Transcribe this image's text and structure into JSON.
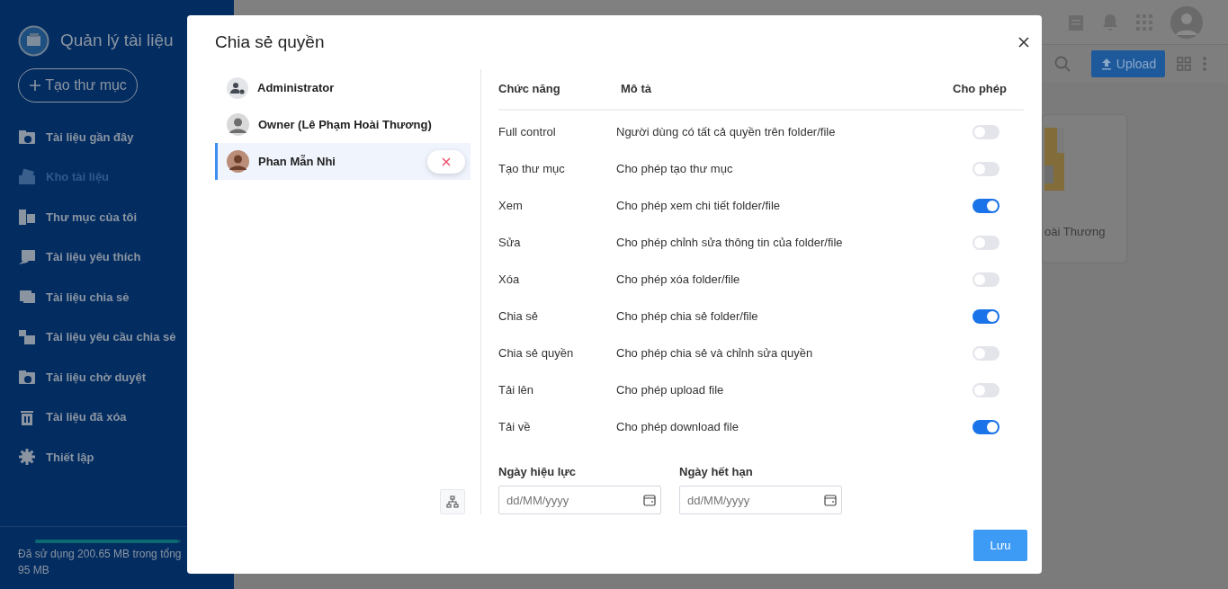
{
  "app": {
    "title": "Quản lý tài liệu",
    "new_folder": "Tạo thư mục"
  },
  "sidebar": {
    "items": [
      {
        "label": "Tài liệu gần đây",
        "selected": false
      },
      {
        "label": "Kho tài liệu",
        "selected": true
      },
      {
        "label": "Thư mục của tôi",
        "selected": false
      },
      {
        "label": "Tài liệu yêu thích",
        "selected": false
      },
      {
        "label": "Tài liệu chia sẻ",
        "selected": false
      },
      {
        "label": "Tài liệu yêu cầu chia sẻ",
        "selected": false
      },
      {
        "label": "Tài liệu chờ duyệt",
        "selected": false
      },
      {
        "label": "Tài liệu đã xóa",
        "selected": false
      },
      {
        "label": "Thiết lập",
        "selected": false
      }
    ],
    "storage": {
      "text": "Đã sử dụng 200.65 MB trong tổng",
      "text_2": "95 MB",
      "level": 0.98
    }
  },
  "toolbar": {
    "upload": "Upload"
  },
  "card": {
    "caption": "oài Thương"
  },
  "dialog": {
    "title": "Chia sẻ quyền",
    "users": [
      {
        "name": "Administrator",
        "kind": "admin",
        "selected": false
      },
      {
        "name": "Owner (Lê Phạm Hoài Thương)",
        "kind": "photo",
        "selected": false
      },
      {
        "name": "Phan Mẫn Nhi",
        "kind": "photo",
        "selected": true
      }
    ],
    "columns": [
      "Chức năng",
      "Mô tả",
      "Cho phép"
    ],
    "permissions": [
      {
        "name": "Full control",
        "description": "Người dùng có tất cả quyền trên folder/file",
        "on": false
      },
      {
        "name": "Tạo thư mục",
        "description": "Cho phép tạo thư mục",
        "on": false
      },
      {
        "name": "Xem",
        "description": "Cho phép xem chi tiết folder/file",
        "on": true
      },
      {
        "name": "Sửa",
        "description": "Cho phép chỉnh sửa thông tin của folder/file",
        "on": false
      },
      {
        "name": "Xóa",
        "description": "Cho phép xóa folder/file",
        "on": false
      },
      {
        "name": "Chia sẻ",
        "description": "Cho phép chia sẻ folder/file",
        "on": true
      },
      {
        "name": "Chia sẻ quyền",
        "description": "Cho phép chia sẻ và chỉnh sửa quyền",
        "on": false
      },
      {
        "name": "Tải lên",
        "description": "Cho phép upload file",
        "on": false
      },
      {
        "name": "Tải về",
        "description": "Cho phép download file",
        "on": true
      }
    ],
    "dates": [
      {
        "label": "Ngày hiệu lực",
        "placeholder": "dd/MM/yyyy"
      },
      {
        "label": "Ngày hết hạn",
        "placeholder": "dd/MM/yyyy"
      }
    ],
    "save": "Lưu"
  }
}
